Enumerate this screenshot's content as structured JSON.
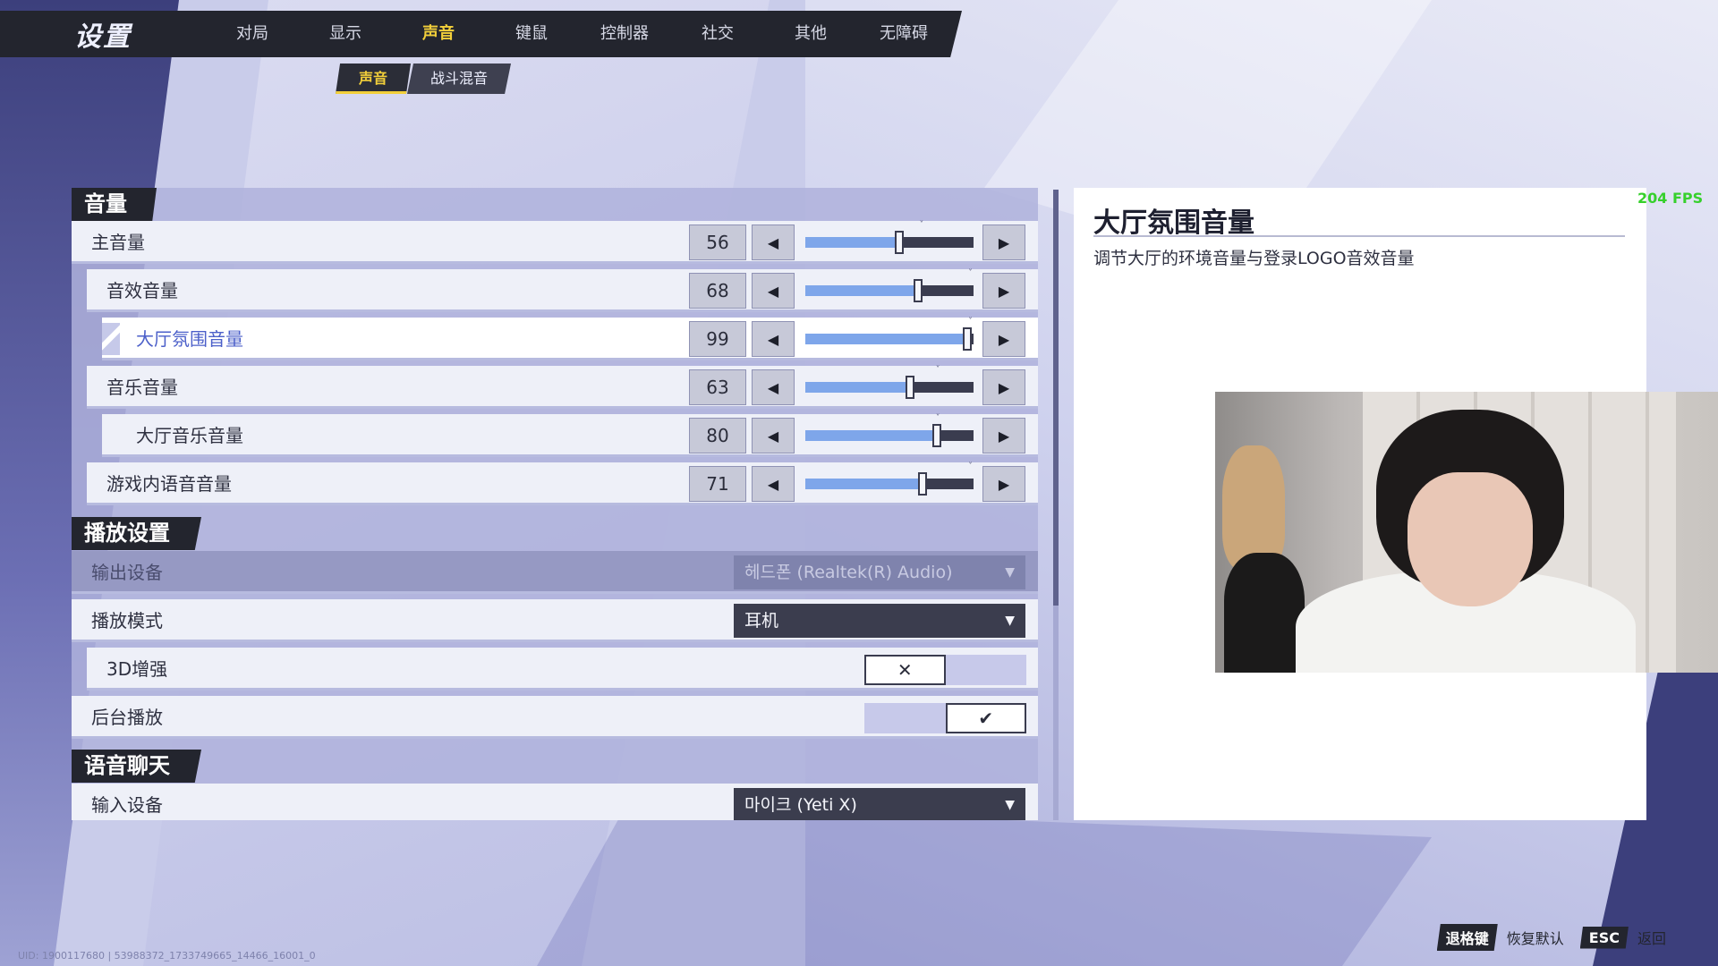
{
  "app_title": "设置",
  "nav": {
    "tabs": [
      {
        "label": "对局"
      },
      {
        "label": "显示"
      },
      {
        "label": "声音",
        "active": true
      },
      {
        "label": "键鼠"
      },
      {
        "label": "控制器"
      },
      {
        "label": "社交"
      },
      {
        "label": "其他"
      },
      {
        "label": "无障碍"
      }
    ],
    "subtabs": [
      {
        "label": "声音",
        "active": true
      },
      {
        "label": "战斗混音"
      }
    ]
  },
  "sections": {
    "volume": "音量",
    "playback": "播放设置",
    "voice_chat": "语音聊天"
  },
  "volume_rows": [
    {
      "label": "主音量",
      "value": "56",
      "level": 56,
      "default_level": 70,
      "indent": 0
    },
    {
      "label": "音效音量",
      "value": "68",
      "level": 68,
      "default_level": 100,
      "indent": 1
    },
    {
      "label": "大厅氛围音量",
      "value": "99",
      "level": 99,
      "default_level": 100,
      "indent": 2,
      "highlighted": true
    },
    {
      "label": "音乐音量",
      "value": "63",
      "level": 63,
      "default_level": 80,
      "indent": 1
    },
    {
      "label": "大厅音乐音量",
      "value": "80",
      "level": 80,
      "default_level": 80,
      "indent": 2
    },
    {
      "label": "游戏内语音音量",
      "value": "71",
      "level": 71,
      "default_level": 100,
      "indent": 1
    }
  ],
  "playback": {
    "output_device": {
      "label": "输出设备",
      "value": "헤드폰 (Realtek(R) Audio)",
      "disabled": true
    },
    "mode": {
      "label": "播放模式",
      "value": "耳机"
    },
    "enhance_3d": {
      "label": "3D增强",
      "enabled": false,
      "off_glyph": "✕"
    },
    "background_play": {
      "label": "后台播放",
      "enabled": true,
      "on_glyph": "✔"
    }
  },
  "voice_chat": {
    "input_device": {
      "label": "输入设备",
      "value": "마이크 (Yeti X)"
    }
  },
  "glyphs": {
    "left": "◀",
    "right": "▶",
    "caret": "▼",
    "default_mark": "˅"
  },
  "description": {
    "title": "大厅氛围音量",
    "text": "调节大厅的环境音量与登录LOGO音效音量"
  },
  "fps": "204 FPS",
  "uid_text": "UID: 1900117680 | 53988372_1733749665_14466_16001_0",
  "hints": [
    {
      "key": "退格键",
      "label": "恢复默认"
    },
    {
      "key": "ESC",
      "label": "返回"
    }
  ],
  "colors": {
    "accent": "#f2cf3a",
    "slider_fill": "#7ea6ea",
    "fps": "#36d02c"
  }
}
